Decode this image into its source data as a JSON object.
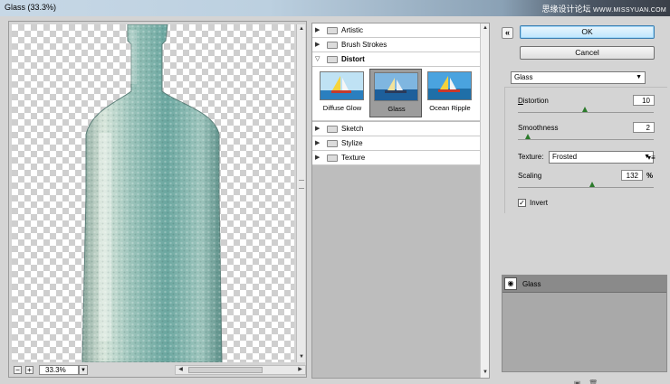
{
  "window": {
    "title": "Glass (33.3%)",
    "watermark": "思缘设计论坛",
    "watermark_url": "WWW.MISSYUAN.COM"
  },
  "preview": {
    "zoom_out": "−",
    "zoom_in": "+",
    "zoom_value": "33.3%"
  },
  "gallery": {
    "categories": [
      {
        "label": "Artistic",
        "expanded": false
      },
      {
        "label": "Brush Strokes",
        "expanded": false
      },
      {
        "label": "Distort",
        "expanded": true
      },
      {
        "label": "Sketch",
        "expanded": false
      },
      {
        "label": "Stylize",
        "expanded": false
      },
      {
        "label": "Texture",
        "expanded": false
      }
    ],
    "distort_filters": [
      {
        "label": "Diffuse Glow",
        "selected": false
      },
      {
        "label": "Glass",
        "selected": true
      },
      {
        "label": "Ocean Ripple",
        "selected": false
      }
    ]
  },
  "buttons": {
    "ok": "OK",
    "cancel": "Cancel"
  },
  "settings": {
    "filter_select": "Glass",
    "distortion": {
      "label": "Distortion",
      "value": "10",
      "level": 0.5
    },
    "smoothness": {
      "label": "Smoothness",
      "value": "2",
      "level": 0.07
    },
    "texture": {
      "label": "Texture:",
      "value": "Frosted"
    },
    "scaling": {
      "label": "Scaling",
      "value": "132",
      "unit": "%",
      "level": 0.55
    },
    "invert": {
      "label": "Invert",
      "checked": true
    }
  },
  "layers": [
    {
      "name": "Glass"
    }
  ],
  "colors": {
    "ok_blue": "#bee6fd",
    "slider_green": "#2b7a2b",
    "checker": "#cfcfcf"
  }
}
